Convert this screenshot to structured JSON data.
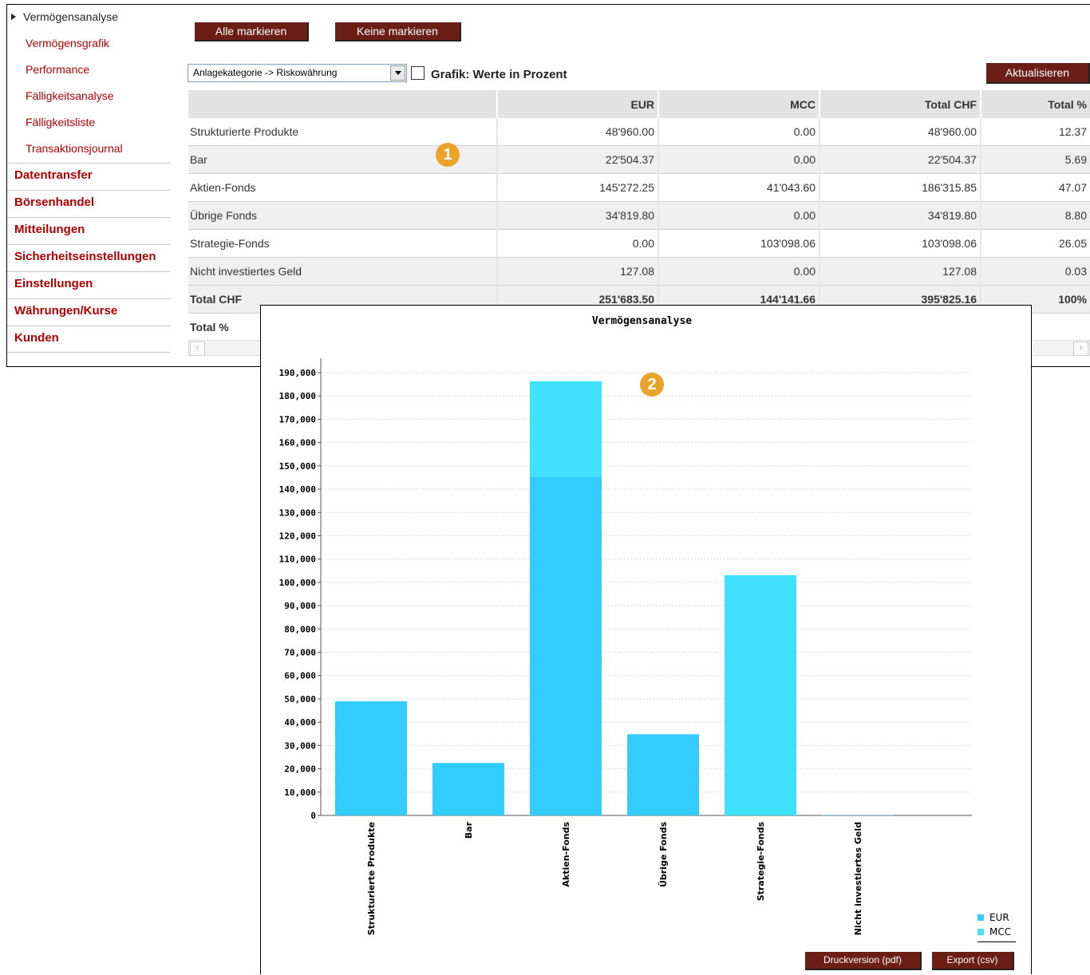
{
  "sidebar": {
    "sub_items": [
      "Vermögensanalyse",
      "Vermögensgrafik",
      "Performance",
      "Fälligkeitsanalyse",
      "Fälligkeitsliste",
      "Transaktionsjournal"
    ],
    "main_items": [
      "Datentransfer",
      "Börsenhandel",
      "Mitteilungen",
      "Sicherheitseinstellungen",
      "Einstellungen",
      "Währungen/Kurse",
      "Kunden"
    ]
  },
  "toolbar": {
    "mark_all": "Alle markieren",
    "mark_none": "Keine markieren",
    "select_value": "Anlagekategorie -> Riskowährung",
    "checkbox_label": "Grafik: Werte in Prozent",
    "update": "Aktualisieren"
  },
  "table": {
    "headers": [
      "",
      "EUR",
      "MCC",
      "Total CHF",
      "Total %"
    ],
    "rows": [
      [
        "Strukturierte Produkte",
        "48'960.00",
        "0.00",
        "48'960.00",
        "12.37"
      ],
      [
        "Bar",
        "22'504.37",
        "0.00",
        "22'504.37",
        "5.69"
      ],
      [
        "Aktien-Fonds",
        "145'272.25",
        "41'043.60",
        "186'315.85",
        "47.07"
      ],
      [
        "Übrige Fonds",
        "34'819.80",
        "0.00",
        "34'819.80",
        "8.80"
      ],
      [
        "Strategie-Fonds",
        "0.00",
        "103'098.06",
        "103'098.06",
        "26.05"
      ],
      [
        "Nicht investiertes Geld",
        "127.08",
        "0.00",
        "127.08",
        "0.03"
      ]
    ],
    "total_chf": [
      "Total CHF",
      "251'683.50",
      "144'141.66",
      "395'825.16",
      "100%"
    ],
    "total_pct_label": "Total %"
  },
  "badges": [
    "1",
    "2"
  ],
  "chart_footer": {
    "pdf": "Druckversion (pdf)",
    "csv": "Export (csv)"
  },
  "chart_data": {
    "type": "bar",
    "stacked": true,
    "title": "Vermögensanalyse",
    "categories": [
      "Strukturierte Produkte",
      "Bar",
      "Aktien-Fonds",
      "Übrige Fonds",
      "Strategie-Fonds",
      "Nicht investiertes Geld"
    ],
    "series": [
      {
        "name": "EUR",
        "color": "#33ccff",
        "values": [
          48960.0,
          22504.37,
          145272.25,
          34819.8,
          0.0,
          127.08
        ]
      },
      {
        "name": "MCC",
        "color": "#40e0ff",
        "values": [
          0.0,
          0.0,
          41043.6,
          0.0,
          103098.06,
          0.0
        ]
      }
    ],
    "ylim": [
      0,
      190000
    ],
    "ytick_step": 10000,
    "grid": true,
    "legend": "bottom-right"
  }
}
